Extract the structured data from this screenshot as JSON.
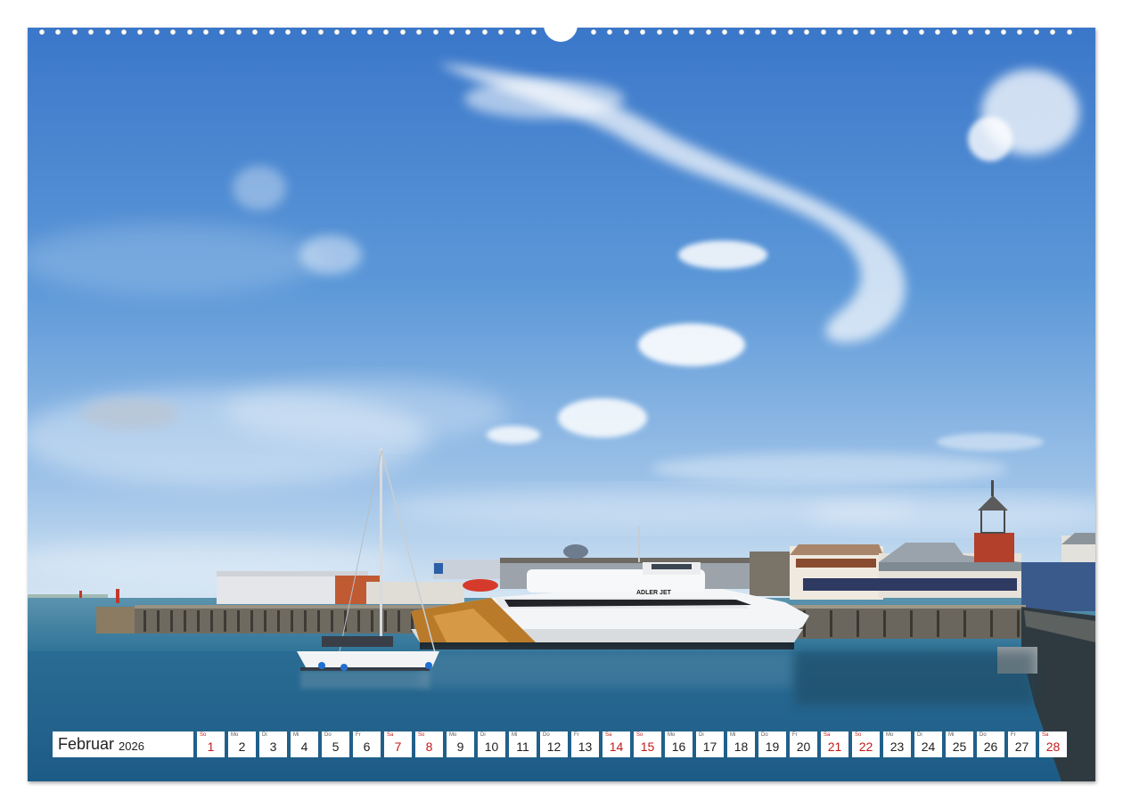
{
  "calendar": {
    "month": "Februar",
    "year": "2026",
    "days": [
      {
        "wd": "So",
        "num": "1",
        "weekend": true
      },
      {
        "wd": "Mo",
        "num": "2",
        "weekend": false
      },
      {
        "wd": "Di",
        "num": "3",
        "weekend": false
      },
      {
        "wd": "Mi",
        "num": "4",
        "weekend": false
      },
      {
        "wd": "Do",
        "num": "5",
        "weekend": false
      },
      {
        "wd": "Fr",
        "num": "6",
        "weekend": false
      },
      {
        "wd": "Sa",
        "num": "7",
        "weekend": true
      },
      {
        "wd": "So",
        "num": "8",
        "weekend": true
      },
      {
        "wd": "Mo",
        "num": "9",
        "weekend": false
      },
      {
        "wd": "Di",
        "num": "10",
        "weekend": false
      },
      {
        "wd": "Mi",
        "num": "11",
        "weekend": false
      },
      {
        "wd": "Do",
        "num": "12",
        "weekend": false
      },
      {
        "wd": "Fr",
        "num": "13",
        "weekend": false
      },
      {
        "wd": "Sa",
        "num": "14",
        "weekend": true
      },
      {
        "wd": "So",
        "num": "15",
        "weekend": true
      },
      {
        "wd": "Mo",
        "num": "16",
        "weekend": false
      },
      {
        "wd": "Di",
        "num": "17",
        "weekend": false
      },
      {
        "wd": "Mi",
        "num": "18",
        "weekend": false
      },
      {
        "wd": "Do",
        "num": "19",
        "weekend": false
      },
      {
        "wd": "Fr",
        "num": "20",
        "weekend": false
      },
      {
        "wd": "Sa",
        "num": "21",
        "weekend": true
      },
      {
        "wd": "So",
        "num": "22",
        "weekend": true
      },
      {
        "wd": "Mo",
        "num": "23",
        "weekend": false
      },
      {
        "wd": "Di",
        "num": "24",
        "weekend": false
      },
      {
        "wd": "Mi",
        "num": "25",
        "weekend": false
      },
      {
        "wd": "Do",
        "num": "26",
        "weekend": false
      },
      {
        "wd": "Fr",
        "num": "27",
        "weekend": false
      },
      {
        "wd": "Sa",
        "num": "28",
        "weekend": true
      }
    ]
  },
  "photo": {
    "ship_name": "ADLER JET"
  },
  "colors": {
    "weekend": "#c21a1a",
    "sky_top": "#3f7fd0",
    "sky_bottom": "#cfe1f2",
    "water": "#2d6f92"
  }
}
